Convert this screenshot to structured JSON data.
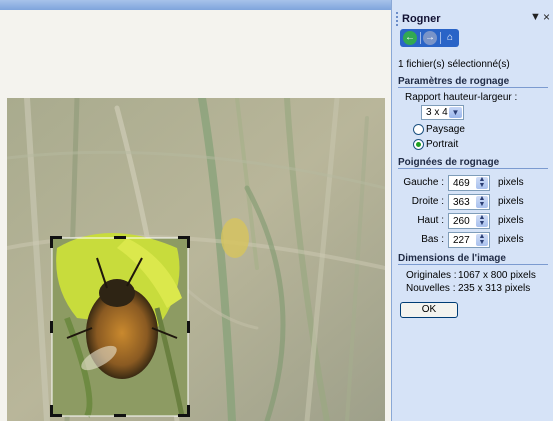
{
  "pane": {
    "title": "Rogner",
    "dropdown_glyph": "▼",
    "close_glyph": "×",
    "nav_icons": [
      "back-icon",
      "forward-icon",
      "home-icon"
    ],
    "selection_info": "1 fichier(s) sélectionné(s)",
    "crop_settings": {
      "heading": "Paramètres de rognage",
      "ratio_label": "Rapport hauteur-largeur :",
      "ratio_value": "3 x 4",
      "landscape_label": "Paysage",
      "portrait_label": "Portrait",
      "selected_orientation": "Portrait"
    },
    "crop_handles": {
      "heading": "Poignées de rognage",
      "unit": "pixels",
      "left_label": "Gauche :",
      "left_value": "469",
      "right_label": "Droite :",
      "right_value": "363",
      "top_label": "Haut :",
      "top_value": "260",
      "bottom_label": "Bas :",
      "bottom_value": "227"
    },
    "dimensions": {
      "heading": "Dimensions de l'image",
      "original_label": "Originales :",
      "original_value": "1067 x 800 pixels",
      "new_label": "Nouvelles :",
      "new_value": "235 x 313 pixels"
    },
    "ok_label": "OK"
  },
  "colors": {
    "pane_bg": "#d6e3f7",
    "nav_bar": "#2a64c7",
    "heading_rule": "#7c9bd0"
  }
}
